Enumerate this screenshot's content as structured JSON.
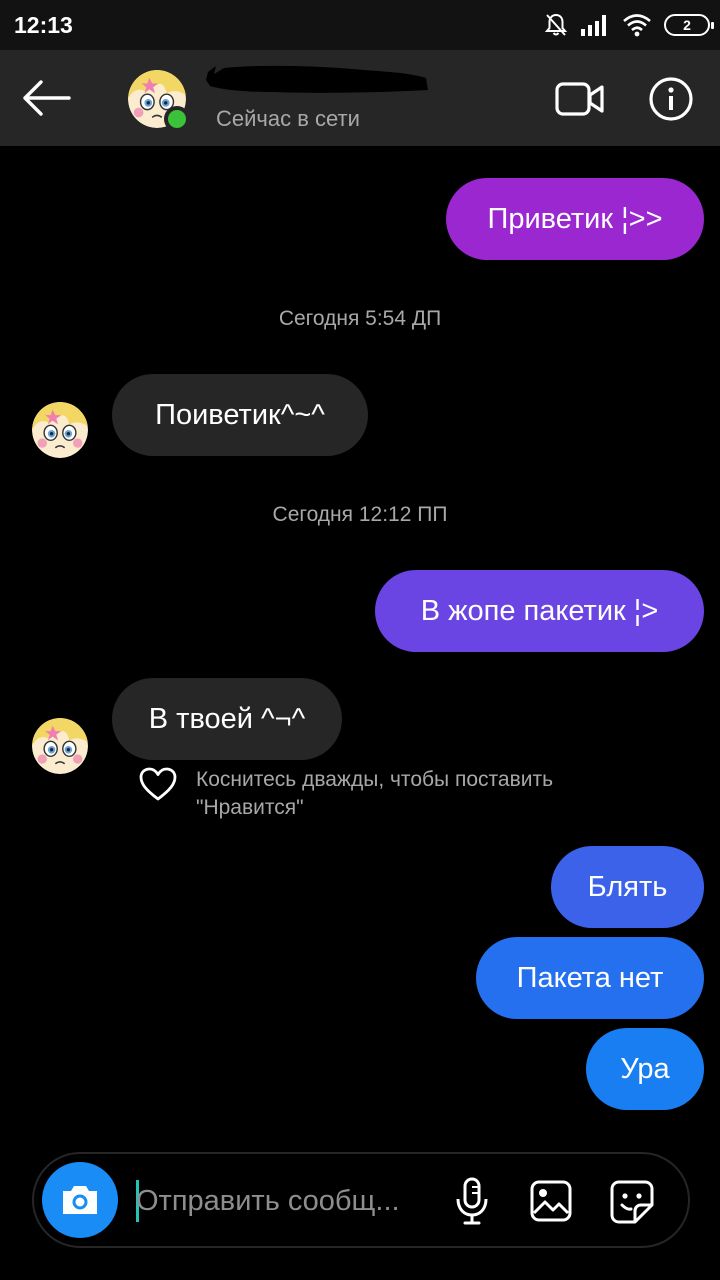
{
  "status_bar": {
    "time": "12:13",
    "battery": "2"
  },
  "header": {
    "contact_status": "Сейчас в сети"
  },
  "messages": [
    {
      "text": "Приветик ¦>>"
    },
    {
      "timestamp": "Сегодня 5:54 ДП"
    },
    {
      "text": "Поиветик^~^"
    },
    {
      "timestamp": "Сегодня 12:12 ПП"
    },
    {
      "text": "В жопе пакетик ¦>"
    },
    {
      "text": "В твоей ^¬^"
    },
    {
      "text": "Блять"
    },
    {
      "text": "Пакета нет"
    },
    {
      "text": "Ура"
    }
  ],
  "like_hint": "Коснитесь дважды, чтобы поставить \"Нравится\"",
  "composer": {
    "placeholder": "Отправить сообщ..."
  },
  "colors": {
    "header_bg": "#262626",
    "incoming_bubble": "#262626",
    "outgoing_gradient": [
      "#9b27d1",
      "#7b3be0",
      "#5a4fe6",
      "#3667ea",
      "#1f73f0",
      "#1a7ef3"
    ],
    "online": "#3ac23a",
    "camera_button": "#1a8cf6"
  },
  "icons": [
    "back-arrow-icon",
    "video-call-icon",
    "info-icon",
    "heart-icon",
    "camera-icon",
    "microphone-icon",
    "gallery-icon",
    "sticker-icon",
    "mute-icon",
    "signal-icon",
    "wifi-icon",
    "battery-icon"
  ]
}
